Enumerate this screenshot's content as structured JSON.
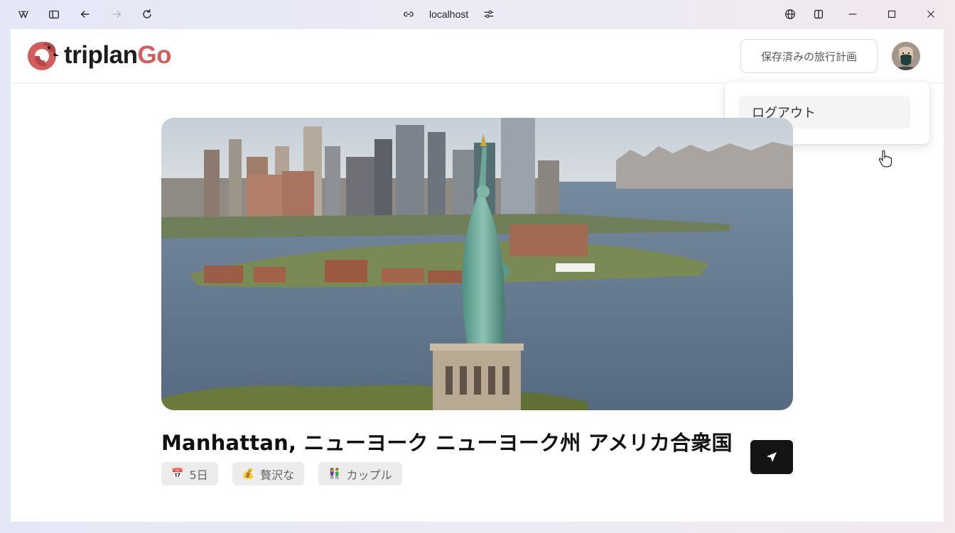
{
  "browser": {
    "url": "localhost",
    "buttons": {
      "app_menu": "app-menu-icon",
      "sidebar": "sidebar-toggle-icon",
      "back": "back-arrow-icon",
      "forward": "forward-arrow-icon",
      "reload": "reload-icon",
      "site_info": "link-icon",
      "tune": "sliders-icon",
      "translate": "globe-icon",
      "split_view": "split-view-icon",
      "minimize": "minimize-icon",
      "maximize": "maximize-icon",
      "close": "close-icon"
    }
  },
  "header": {
    "logo_part1": "triplan",
    "logo_part2": "Go",
    "saved_plans_label": "保存済みの旅行計画"
  },
  "dropdown": {
    "logout_label": "ログアウト"
  },
  "trip": {
    "title": "Manhattan, ニューヨーク ニューヨーク州 アメリカ合衆国",
    "chips": [
      {
        "icon": "calendar-icon",
        "label": "5日"
      },
      {
        "icon": "money-bag-icon",
        "label": "贅沢な"
      },
      {
        "icon": "couple-icon",
        "label": "カップル"
      }
    ],
    "share_icon": "send-icon"
  },
  "colors": {
    "brand_red": "#d25d5d",
    "brand_dark": "#1d1d1f",
    "send_button": "#141414"
  }
}
